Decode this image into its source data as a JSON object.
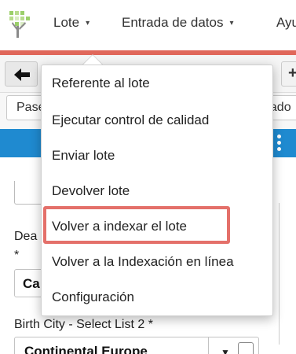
{
  "menu": {
    "items": [
      {
        "label": "Lote",
        "caret": "▾"
      },
      {
        "label": "Entrada de datos",
        "caret": "▾"
      },
      {
        "label": "Ayu"
      }
    ]
  },
  "toolbar": {
    "back_icon": "back-arrow-icon",
    "plus_label": "+"
  },
  "row2": {
    "left_field": "Pase",
    "right_field": "dado"
  },
  "dropdown": {
    "items": [
      "Referente al lote",
      "Ejecutar control de calidad",
      "Enviar lote",
      "Devolver lote",
      "Volver a indexar el lote",
      "Volver a la Indexación en línea",
      "Configuración"
    ],
    "highlighted_index": 4
  },
  "form": {
    "dea_label": "Dea",
    "required_mark": "*",
    "ca_value": "Ca",
    "birth_city_label": "Birth City - Select List 2 *",
    "birth_city_value": "Continental Europe"
  },
  "colors": {
    "accent_bar": "#e0675a",
    "blue_band": "#1f8ad0",
    "highlight_border": "#e4706a"
  }
}
